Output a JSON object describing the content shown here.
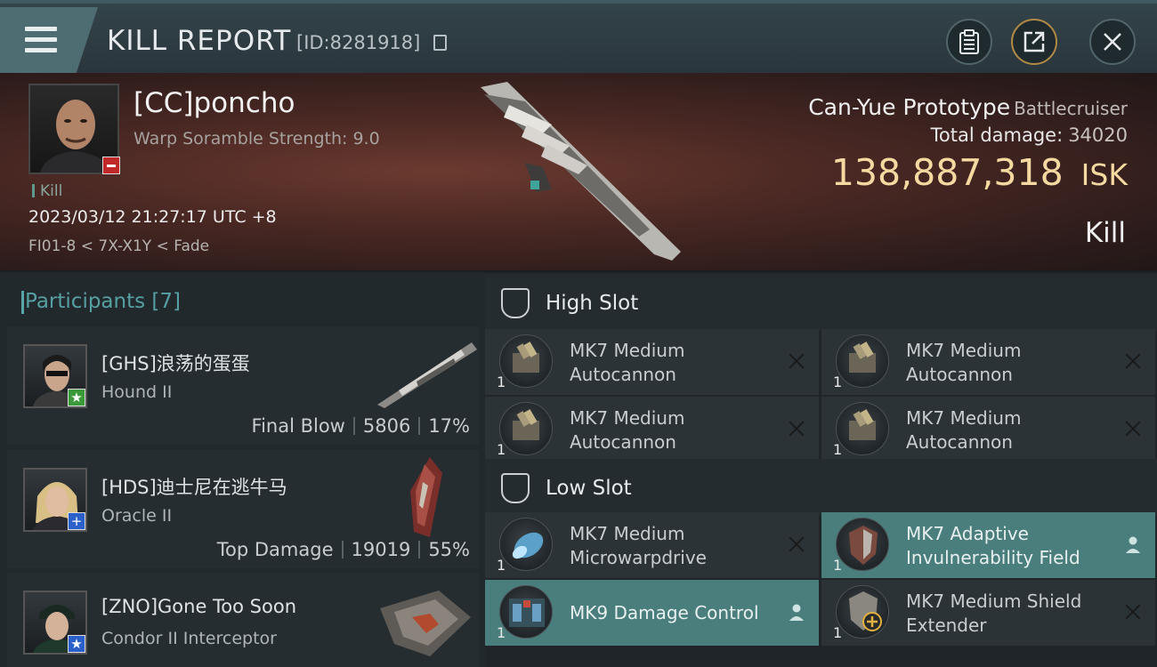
{
  "header": {
    "title": "KILL REPORT",
    "report_id": "[ID:8281918]"
  },
  "victim": {
    "name": "[CC]poncho",
    "subtitle": "Warp Soramble Strength: 9.0",
    "tag": "Kill",
    "datetime": "2023/03/12 21:27:17 UTC +8",
    "location": "FI01-8 < 7X-X1Y < Fade",
    "ship_name": "Can-Yue Prototype",
    "ship_class": "Battlecruiser",
    "total_damage_label": "Total damage:",
    "total_damage": "34020",
    "isk_value": "138,887,318",
    "isk_unit": "ISK",
    "result": "Kill"
  },
  "participants": {
    "title": "Participants [7]",
    "items": [
      {
        "name": "[GHS]浪荡的蛋蛋",
        "ship": "Hound II",
        "role": "Final Blow",
        "damage": "5806",
        "percent": "17%",
        "tag": "★",
        "tag_color": "green"
      },
      {
        "name": "[HDS]迪士尼在逃牛马",
        "ship": "Oracle II",
        "role": "Top Damage",
        "damage": "19019",
        "percent": "55%",
        "tag": "+",
        "tag_color": "blue"
      },
      {
        "name": "[ZNO]Gone Too Soon",
        "ship": "Condor II Interceptor",
        "tag": "★",
        "tag_color": "blue"
      }
    ]
  },
  "slots": {
    "high": {
      "title": "High Slot",
      "items": [
        {
          "line1": "MK7 Medium",
          "line2": "Autocannon",
          "qty": "1",
          "state": "destroyed"
        },
        {
          "line1": "MK7 Medium",
          "line2": "Autocannon",
          "qty": "1",
          "state": "destroyed"
        },
        {
          "line1": "MK7 Medium",
          "line2": "Autocannon",
          "qty": "1",
          "state": "destroyed"
        },
        {
          "line1": "MK7 Medium",
          "line2": "Autocannon",
          "qty": "1",
          "state": "destroyed"
        }
      ]
    },
    "low": {
      "title": "Low Slot",
      "items": [
        {
          "line1": "MK7 Medium",
          "line2": "Microwarpdrive",
          "qty": "1",
          "state": "destroyed"
        },
        {
          "line1": "MK7 Adaptive",
          "line2": "Invulnerability Field",
          "qty": "1",
          "state": "dropped"
        },
        {
          "line1": "MK9 Damage Control",
          "line2": "",
          "qty": "1",
          "state": "dropped"
        },
        {
          "line1": "MK7 Medium Shield",
          "line2": "Extender",
          "qty": "1",
          "state": "destroyed"
        }
      ]
    }
  },
  "colors": {
    "accent": "#56a0a3",
    "isk": "#f5d9a0",
    "fitted": "#4a7e7d",
    "destroyed_badge": "#c0282a"
  }
}
